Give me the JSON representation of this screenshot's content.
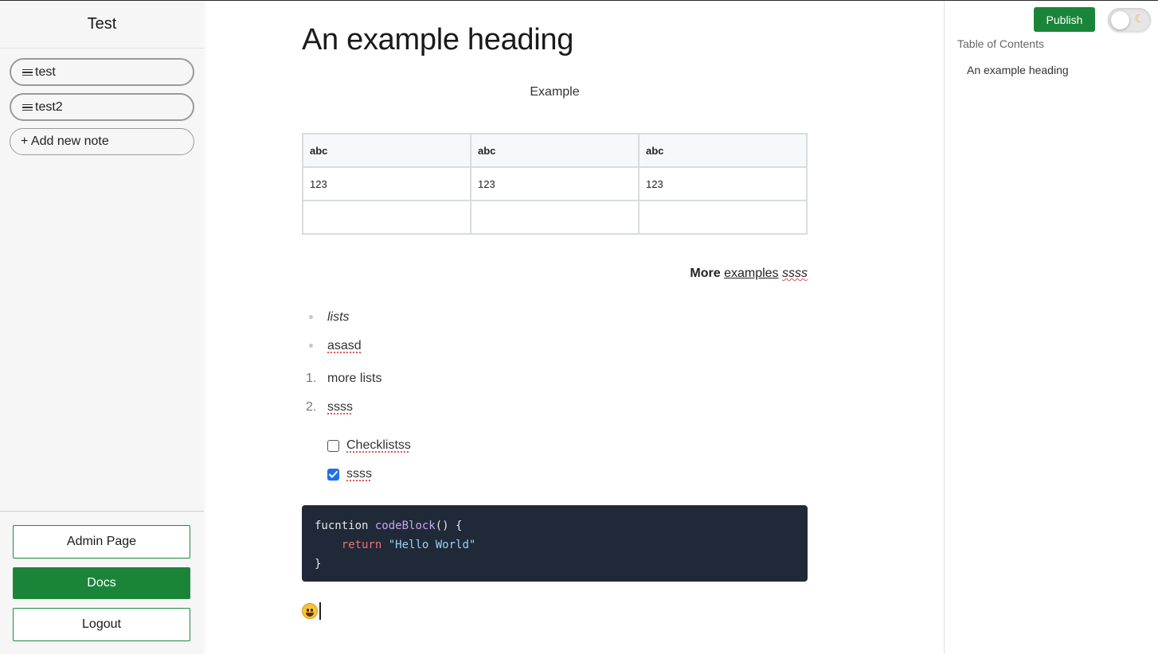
{
  "sidebar": {
    "title": "Test",
    "notes": [
      {
        "label": "test"
      },
      {
        "label": "test2"
      }
    ],
    "add_note_label": "+ Add new note",
    "buttons": {
      "admin": "Admin Page",
      "docs": "Docs",
      "logout": "Logout"
    }
  },
  "editor": {
    "heading": "An example heading",
    "center_paragraph": "Example",
    "table": {
      "headers": [
        "abc",
        "abc",
        "abc"
      ],
      "rows": [
        [
          "123",
          "123",
          "123"
        ],
        [
          "",
          "",
          ""
        ]
      ]
    },
    "right_paragraph": {
      "bold": "More",
      "underlined": "examples",
      "italic": "ssss"
    },
    "bullet_list": [
      "lists",
      "asasd"
    ],
    "ordered_list": [
      {
        "num": "1.",
        "text": "more lists"
      },
      {
        "num": "2.",
        "text": "ssss"
      }
    ],
    "checklist": [
      {
        "text": "Checklistss",
        "checked": false
      },
      {
        "text": "ssss",
        "checked": true
      }
    ],
    "code": {
      "line1_kw": "fucntion",
      "line1_fn": "codeBlock",
      "line1_rest": "() {",
      "line2_kw": "return",
      "line2_str": "\"Hello World\"",
      "line3": "}"
    },
    "emoji": "grinning-face-emoji"
  },
  "right_panel": {
    "publish_label": "Publish",
    "toc_title": "Table of Contents",
    "toc_items": [
      "An example heading"
    ],
    "toggle_icon": "moon-icon"
  },
  "colors": {
    "accent_green": "#1a8539",
    "code_bg": "#1f2937",
    "checkbox_blue": "#1f6feb"
  }
}
